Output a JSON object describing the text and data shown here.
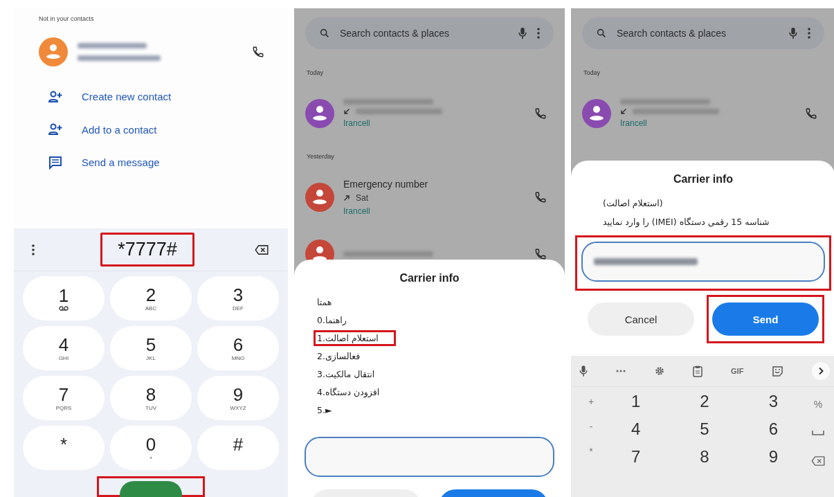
{
  "panels": [
    {
      "kind": "dialer",
      "section_label": "Not in your contacts",
      "contact": {
        "color": "#f08a3a"
      },
      "actions": [
        {
          "kind": "contact",
          "label": "Create new contact"
        },
        {
          "kind": "contact",
          "label": "Add to a contact"
        },
        {
          "kind": "message",
          "label": "Send a message"
        }
      ],
      "dial": {
        "number": "*7777#",
        "highlighted": true
      },
      "keys": [
        {
          "digit": "1",
          "kind": "voicemail"
        },
        {
          "digit": "2",
          "letters": "ABC"
        },
        {
          "digit": "3",
          "letters": "DEF"
        },
        {
          "digit": "4",
          "letters": "GHI"
        },
        {
          "digit": "5",
          "letters": "JKL"
        },
        {
          "digit": "6",
          "letters": "MNO"
        },
        {
          "digit": "7",
          "letters": "PQRS"
        },
        {
          "digit": "8",
          "letters": "TUV"
        },
        {
          "digit": "9",
          "letters": "WXYZ"
        },
        {
          "digit": "*"
        },
        {
          "digit": "0",
          "letters": "+"
        },
        {
          "digit": "#"
        }
      ],
      "call_button": {
        "highlighted": true
      }
    },
    {
      "kind": "carrier_menu",
      "search": {
        "placeholder": "Search contacts & places"
      },
      "groups": [
        {
          "label": "Today",
          "calls": [
            {
              "color": "#8a4bb0",
              "incoming": true,
              "carrier": "Irancell"
            }
          ]
        },
        {
          "label": "Yesterday",
          "calls": [
            {
              "color": "#c4473a",
              "name": "Emergency number",
              "incoming": false,
              "detail": "Sat",
              "carrier": "Irancell"
            },
            {
              "color": "#c4473a"
            }
          ]
        }
      ],
      "dialog": {
        "title": "Carrier info",
        "lines": [
          {
            "text": "همتا",
            "highlighted": false
          },
          {
            "text": "0.راهنما",
            "highlighted": false
          },
          {
            "text": "1.استعلام اصالت",
            "highlighted": true
          },
          {
            "text": "2.فعالسازی",
            "highlighted": false
          },
          {
            "text": "3.انتقال مالکیت",
            "highlighted": false
          },
          {
            "text": "4.افزودن دستگاه",
            "highlighted": false
          },
          {
            "text": "5.►",
            "highlighted": false
          }
        ],
        "input": {
          "filled": false,
          "highlighted": false
        },
        "buttons": [
          {
            "kind": "secondary"
          },
          {
            "kind": "primary"
          }
        ]
      }
    },
    {
      "kind": "carrier_input",
      "search": {
        "placeholder": "Search contacts & places"
      },
      "groups": [
        {
          "label": "Today",
          "calls": [
            {
              "color": "#8a4bb0",
              "incoming": true,
              "carrier": "Irancell"
            }
          ]
        }
      ],
      "dialog": {
        "title": "Carrier info",
        "message": [
          "(استعلام اصالت)",
          "شناسه 15 رقمی دستگاه (IMEI) را وارد نمایید"
        ],
        "input": {
          "filled": true,
          "highlighted": true
        },
        "buttons": [
          {
            "kind": "secondary",
            "label": "Cancel",
            "highlighted": false
          },
          {
            "kind": "primary",
            "label": "Send",
            "highlighted": true
          }
        ]
      },
      "keyboard": {
        "toolbar": [
          {
            "kind": "mic"
          },
          {
            "kind": "more"
          },
          {
            "kind": "gear"
          },
          {
            "kind": "clipboard"
          },
          {
            "kind": "text",
            "label": "GIF"
          },
          {
            "kind": "sticker"
          },
          {
            "kind": "chevron"
          }
        ],
        "symbols": [
          "+",
          "-",
          "*"
        ],
        "digits": [
          "1",
          "2",
          "3",
          "4",
          "5",
          "6",
          "7",
          "8",
          "9"
        ],
        "side": [
          {
            "kind": "text",
            "label": "%"
          },
          {
            "kind": "space"
          },
          {
            "kind": "backspace"
          }
        ]
      }
    }
  ]
}
